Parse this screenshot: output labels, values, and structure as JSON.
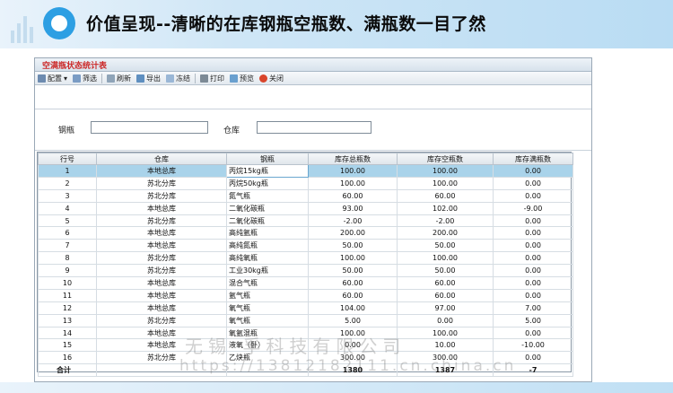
{
  "header": {
    "title": "价值呈现--清晰的在库钢瓶空瓶数、满瓶数一目了然"
  },
  "window": {
    "title": "空满瓶状态统计表"
  },
  "toolbar": {
    "items": [
      {
        "label": "配置",
        "icon": "config-icon"
      },
      {
        "label": "筛选",
        "icon": "filter-icon"
      },
      {
        "label": "刷新",
        "icon": "refresh-icon"
      },
      {
        "label": "导出",
        "icon": "export-icon"
      },
      {
        "label": "冻结",
        "icon": "freeze-icon"
      },
      {
        "label": "打印",
        "icon": "print-icon"
      },
      {
        "label": "预览",
        "icon": "preview-icon"
      },
      {
        "label": "关闭",
        "icon": "close-icon"
      }
    ]
  },
  "filter": {
    "cylinder_label": "钢瓶",
    "cylinder_value": "",
    "warehouse_label": "仓库",
    "warehouse_value": ""
  },
  "table": {
    "columns": [
      "行号",
      "仓库",
      "钢瓶",
      "库存总瓶数",
      "库存空瓶数",
      "库存满瓶数"
    ],
    "rows": [
      [
        "1",
        "本地总库",
        "丙烷15kg瓶",
        "100.00",
        "100.00",
        "0.00"
      ],
      [
        "2",
        "苏北分库",
        "丙烷50kg瓶",
        "100.00",
        "100.00",
        "0.00"
      ],
      [
        "3",
        "苏北分库",
        "氮气瓶",
        "60.00",
        "60.00",
        "0.00"
      ],
      [
        "4",
        "本地总库",
        "二氧化碳瓶",
        "93.00",
        "102.00",
        "-9.00"
      ],
      [
        "5",
        "苏北分库",
        "二氧化碳瓶",
        "-2.00",
        "-2.00",
        "0.00"
      ],
      [
        "6",
        "本地总库",
        "高纯氩瓶",
        "200.00",
        "200.00",
        "0.00"
      ],
      [
        "7",
        "本地总库",
        "高纯氮瓶",
        "50.00",
        "50.00",
        "0.00"
      ],
      [
        "8",
        "苏北分库",
        "高纯氧瓶",
        "100.00",
        "100.00",
        "0.00"
      ],
      [
        "9",
        "苏北分库",
        "工业30kg瓶",
        "50.00",
        "50.00",
        "0.00"
      ],
      [
        "10",
        "本地总库",
        "混合气瓶",
        "60.00",
        "60.00",
        "0.00"
      ],
      [
        "11",
        "本地总库",
        "氩气瓶",
        "60.00",
        "60.00",
        "0.00"
      ],
      [
        "12",
        "本地总库",
        "氧气瓶",
        "104.00",
        "97.00",
        "7.00"
      ],
      [
        "13",
        "苏北分库",
        "氧气瓶",
        "5.00",
        "0.00",
        "5.00"
      ],
      [
        "14",
        "本地总库",
        "氧氩混瓶",
        "100.00",
        "100.00",
        "0.00"
      ],
      [
        "15",
        "本地总库",
        "液氧（卧）",
        "0.00",
        "10.00",
        "-10.00"
      ],
      [
        "16",
        "苏北分库",
        "乙炔瓶",
        "300.00",
        "300.00",
        "0.00"
      ]
    ],
    "total": {
      "label": "合计",
      "total": "1380",
      "empty": "1387",
      "full": "-7"
    }
  },
  "watermark": {
    "line1": "无锡  孚科技有限公司",
    "line2": "https://13812182111.cn.china.cn"
  },
  "colors": {
    "accent": "#2d9fe3",
    "selected_row": "#a9d3ea",
    "window_title": "#cc2a2a"
  }
}
